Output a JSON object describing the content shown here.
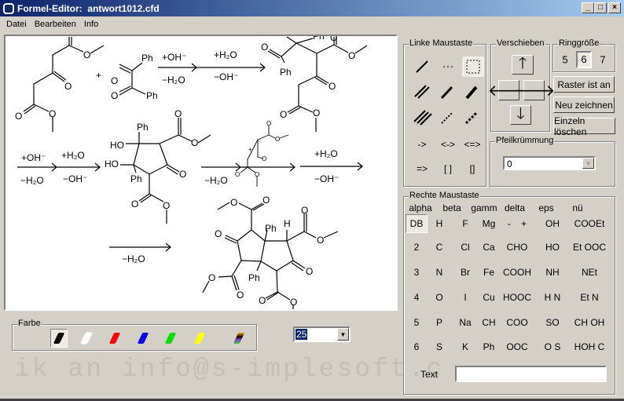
{
  "window": {
    "title": "Formel-Editor:  antwort1012.cfd",
    "minimize": "_",
    "maximize": "□",
    "close": "×"
  },
  "menu": [
    "Datei",
    "Bearbeiten",
    "Info"
  ],
  "canvas": {
    "atoms": {
      "o": "O",
      "ph": "Ph",
      "ho": "HO",
      "h": "H",
      "plus": "+"
    },
    "reagents": {
      "plus_oh": "+OH⁻",
      "minus_h2o": "−H₂O",
      "plus_h2o": "+H₂O",
      "minus_oh": "−OH⁻"
    }
  },
  "colors": {
    "label": "Farbe",
    "swatches": [
      "#000000",
      "#ffffff",
      "#ff0000",
      "#0000e0",
      "#00dd00",
      "#ffff00",
      "multi"
    ]
  },
  "size_select": {
    "value": "25"
  },
  "watermark": "ik an info@s-implesoft.c",
  "left_mouse": {
    "label": "Linke Maustaste",
    "tools": [
      "single-bond",
      "dashed-bond",
      "select-rectangle",
      "double-bond",
      "wedge-bond",
      "bold-wedge-bond",
      "triple-bond",
      "hashed-wedge",
      "hashed-bold-wedge"
    ],
    "text_tools": [
      "->",
      "<->",
      "<=>",
      "=>",
      "[ ]",
      "[]"
    ]
  },
  "move": {
    "label": "Verschieben"
  },
  "ring_size": {
    "label": "Ringgröße",
    "options": [
      "5",
      "6",
      "7"
    ],
    "selected": "6"
  },
  "buttons": {
    "grid": "Raster ist an",
    "redraw": "Neu zeichnen",
    "delete_single": "Einzeln löschen"
  },
  "arrow_curvature": {
    "label": "Pfeilkrümmung",
    "value": "0"
  },
  "right_mouse": {
    "label": "Rechte Maustaste",
    "headers": [
      "alpha",
      "beta",
      "gamm",
      "delta",
      "eps",
      "nü"
    ],
    "rows": [
      [
        "DB",
        "H",
        "F",
        "Mg",
        "-    +",
        "OH",
        "COOEt"
      ],
      [
        "2",
        "C",
        "Cl",
        "Ca",
        "CHO",
        "HO",
        "Et OOC"
      ],
      [
        "3",
        "N",
        "Br",
        "Fe",
        "COOH",
        "NH",
        "NEt"
      ],
      [
        "4",
        "O",
        "I",
        "Cu",
        "HOOC",
        "H N",
        "Et N"
      ],
      [
        "5",
        "P",
        "Na",
        "CH",
        "COO",
        "SO",
        "CH OH"
      ],
      [
        "6",
        "S",
        "K",
        "Ph",
        "OOC",
        "O S",
        "HOH C"
      ]
    ],
    "text_label": "Text",
    "text_value": ""
  }
}
